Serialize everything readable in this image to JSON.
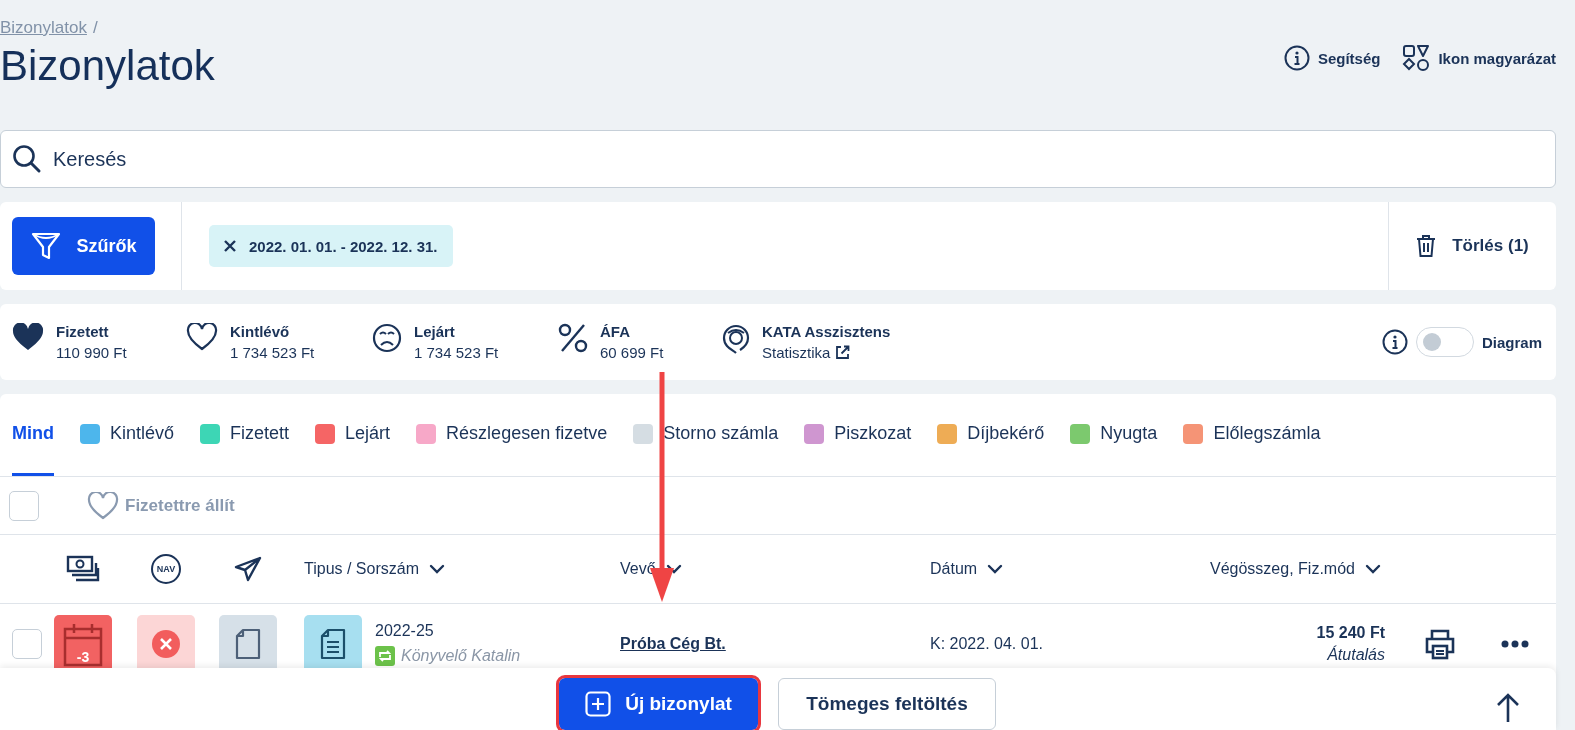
{
  "breadcrumb": {
    "link": "Bizonylatok",
    "separator": "/"
  },
  "page_title": "Bizonylatok",
  "header_actions": [
    {
      "kind": "help",
      "label": "Segítség"
    },
    {
      "kind": "legend",
      "label": "Ikon magyarázat"
    }
  ],
  "search": {
    "placeholder": "Keresés"
  },
  "filters": {
    "button": "Szűrők",
    "chips": [
      "2022. 01. 01. - 2022. 12. 31."
    ],
    "clear": "Törlés (1)"
  },
  "stats": [
    {
      "kind": "paid",
      "label": "Fizetett",
      "value": "110 990 Ft"
    },
    {
      "kind": "outstanding",
      "label": "Kintlévő",
      "value": "1 734 523 Ft"
    },
    {
      "kind": "overdue",
      "label": "Lejárt",
      "value": "1 734 523 Ft"
    },
    {
      "kind": "vat",
      "label": "ÁFA",
      "value": "60 699 Ft"
    },
    {
      "kind": "assistant",
      "label": "KATA Asszisztens",
      "value": "Statisztika"
    }
  ],
  "diagram_toggle": {
    "label": "Diagram",
    "on": false
  },
  "tabs": [
    {
      "label": "Mind",
      "selected": true
    },
    {
      "label": "Kintlévő",
      "color": "#4db6ec",
      "selected": false
    },
    {
      "label": "Fizetett",
      "color": "#3dd6b5",
      "selected": false
    },
    {
      "label": "Lejárt",
      "color": "#f56565",
      "selected": false
    },
    {
      "label": "Részlegesen fizetve",
      "color": "#f7a8c8",
      "selected": false
    },
    {
      "label": "Storno számla",
      "color": "#d5dde3",
      "selected": false
    },
    {
      "label": "Piszkozat",
      "color": "#cf96d0",
      "selected": false
    },
    {
      "label": "Díjbekérő",
      "color": "#eeac55",
      "selected": false
    },
    {
      "label": "Nyugta",
      "color": "#7cc96e",
      "selected": false
    },
    {
      "label": "Előlegszámla",
      "color": "#f59476",
      "selected": false
    }
  ],
  "select_all": {
    "checked": false
  },
  "bulk_action": {
    "label": "Fizetettre állít",
    "disabled": true
  },
  "columns": [
    {
      "kind": "payment"
    },
    {
      "kind": "nav",
      "label": "NAV"
    },
    {
      "kind": "sent"
    },
    {
      "kind": "text",
      "label": "Tipus / Sorszám"
    },
    {
      "kind": "text",
      "label": "Vevő"
    },
    {
      "kind": "text",
      "label": "Dátum"
    },
    {
      "kind": "text",
      "label": "Végösszeg, Fiz.mód"
    }
  ],
  "rows": [
    {
      "checked": false,
      "due_badge": "-3",
      "nav_error": true,
      "number": "2022-25",
      "author": "Könyvelő Katalin",
      "customer": "Próba Cég Bt.",
      "date": "K: 2022. 04. 01.",
      "amount": "15 240 Ft",
      "payment_method": "Átutalás"
    }
  ],
  "footer": {
    "buttons": [
      {
        "kind": "primary",
        "label": "Új bizonylat"
      },
      {
        "kind": "secondary",
        "label": "Tömeges feltöltés"
      }
    ]
  }
}
